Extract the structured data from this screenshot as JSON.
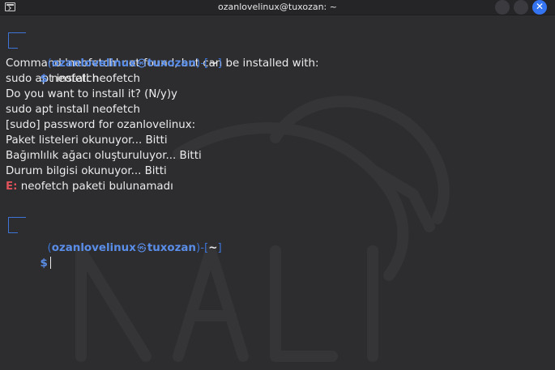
{
  "window": {
    "title": "ozanlovelinux@tuxozan: ~",
    "icon": "terminal-icon",
    "controls": [
      "minimize-button",
      "maximize-button",
      "close-button"
    ],
    "accent_color": "#3574f0"
  },
  "prompt": {
    "user": "ozanlovelinux",
    "host": "tuxozan",
    "dir": "~",
    "symbol": "$"
  },
  "session": {
    "command": "neofetch",
    "output": [
      "Command 'neofetch' not found, but can be installed with:",
      "sudo apt install neofetch",
      "Do you want to install it? (N/y)y",
      "sudo apt install neofetch",
      "[sudo] password for ozanlovelinux:",
      "Paket listeleri okunuyor... Bitti",
      "Bağımlılık ağacı oluşturuluyor... Bitti",
      "Durum bilgisi okunuyor... Bitti"
    ],
    "error_prefix": "E:",
    "error_message": " neofetch paketi bulunamadı"
  },
  "colors": {
    "prompt": "#5a8de8",
    "error": "#e0525a",
    "text": "#ececec",
    "background": "#2d2d30"
  }
}
